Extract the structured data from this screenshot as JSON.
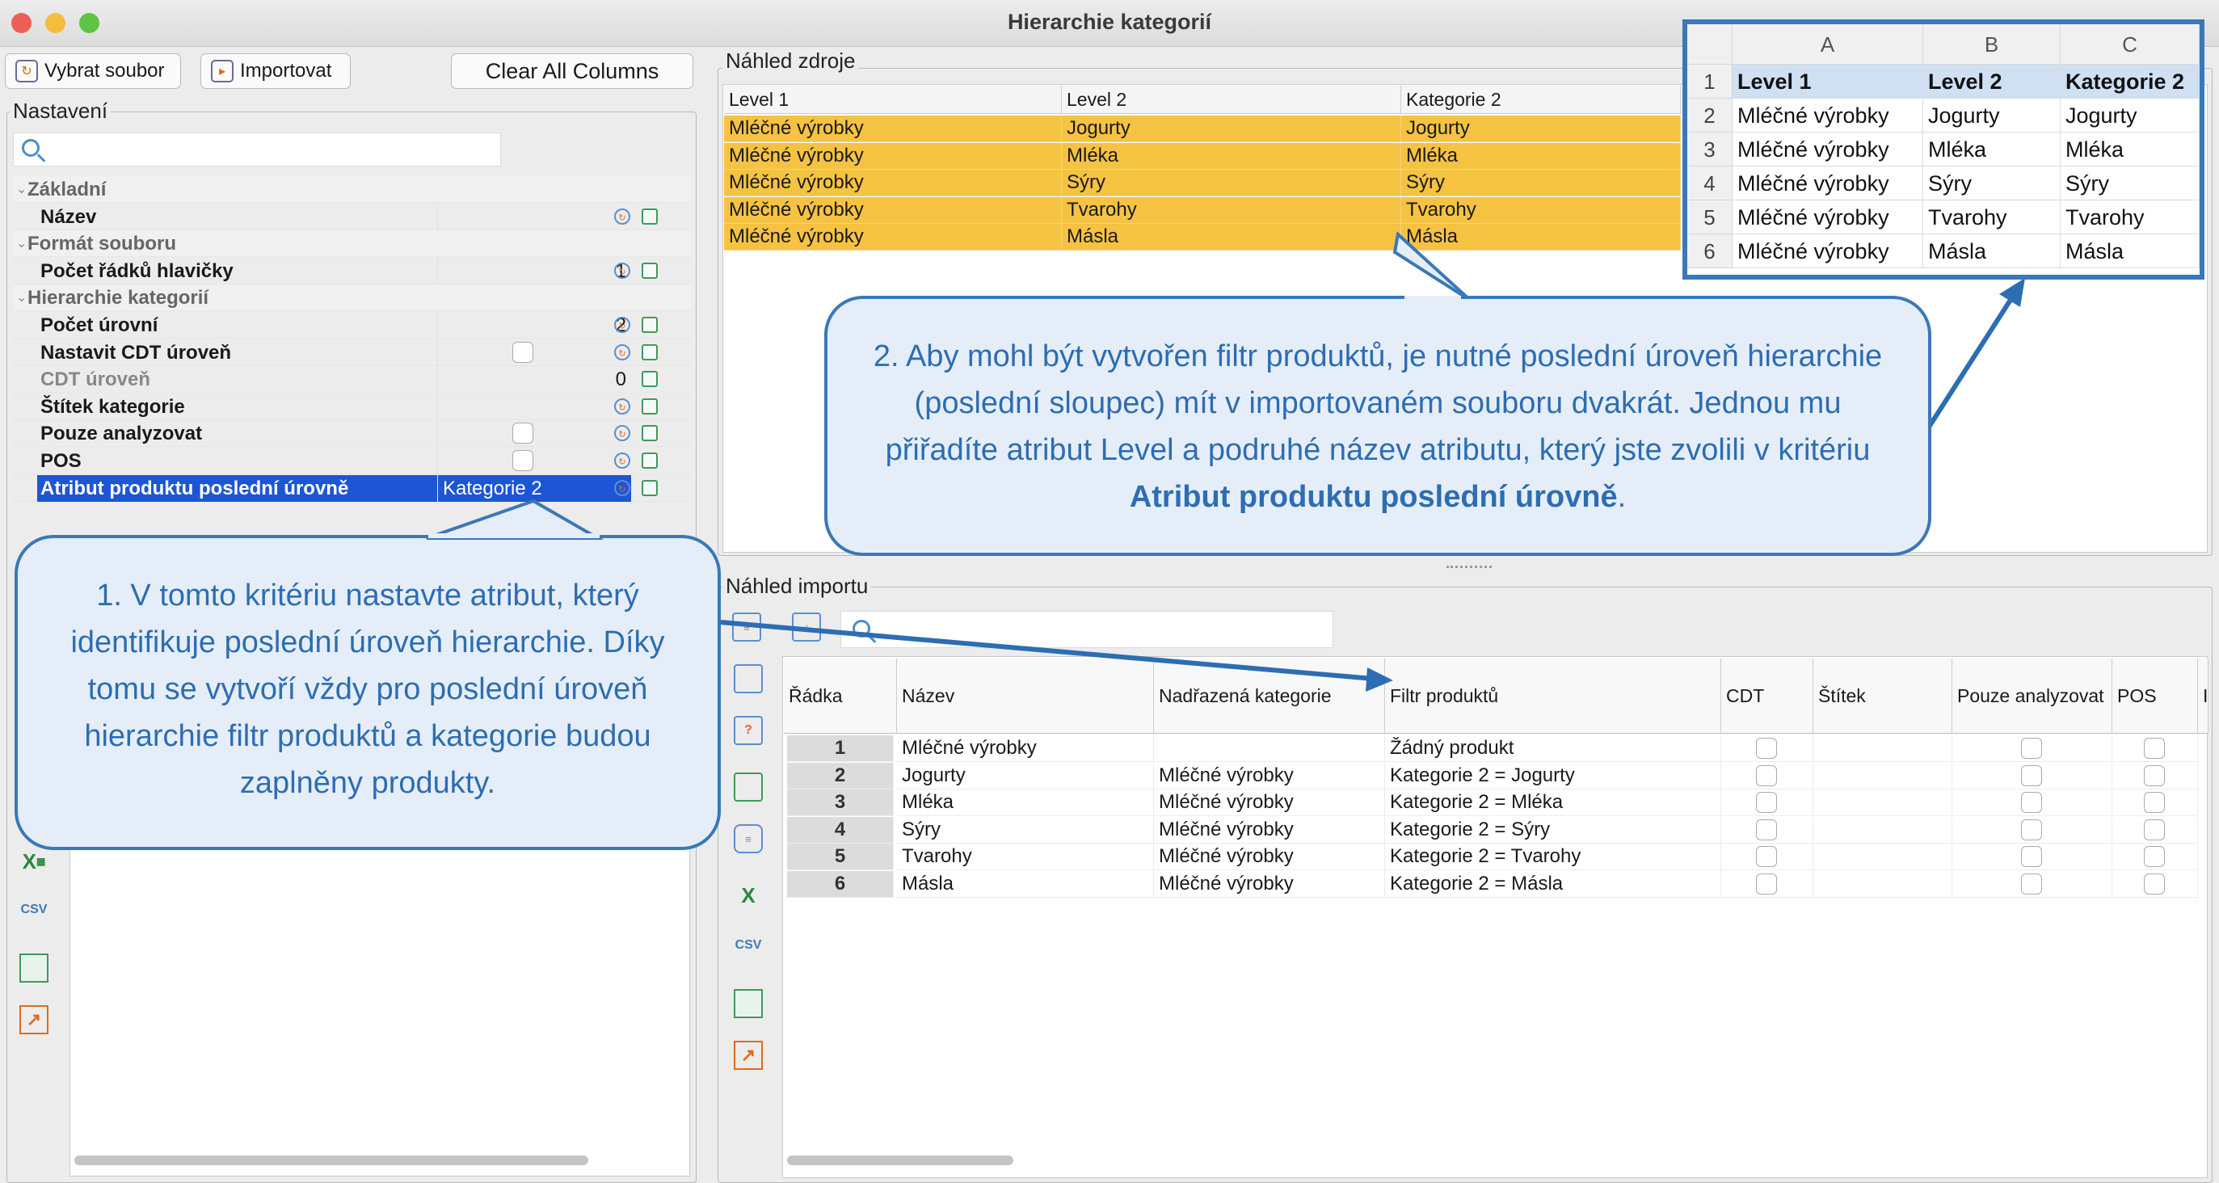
{
  "window": {
    "title": "Hierarchie kategorií"
  },
  "toolbar": {
    "select_file": "Vybrat soubor",
    "import": "Importovat",
    "clear_columns": "Clear All Columns"
  },
  "settings": {
    "group_label": "Nastavení",
    "rows": [
      {
        "label": "Základní",
        "value": ""
      },
      {
        "label": "Název",
        "value": ""
      },
      {
        "label": "Formát souboru",
        "value": ""
      },
      {
        "label": "Počet řádků hlavičky",
        "value": "1"
      },
      {
        "label": "Hierarchie kategorií",
        "value": ""
      },
      {
        "label": "Počet úrovní",
        "value": "2"
      },
      {
        "label": "Nastavit CDT úroveň",
        "value": ""
      },
      {
        "label": "CDT úroveň",
        "value": "0"
      },
      {
        "label": "Štítek kategorie",
        "value": ""
      },
      {
        "label": "Pouze analyzovat",
        "value": ""
      },
      {
        "label": "POS",
        "value": ""
      },
      {
        "label": "Atribut produktu poslední úrovně",
        "value": "Kategorie 2"
      }
    ]
  },
  "source_preview": {
    "label": "Náhled zdroje",
    "headers": [
      "Level 1",
      "Level 2",
      "Kategorie 2"
    ],
    "rows": [
      [
        "Mléčné výrobky",
        "Jogurty",
        "Jogurty"
      ],
      [
        "Mléčné výrobky",
        "Mléka",
        "Mléka"
      ],
      [
        "Mléčné výrobky",
        "Sýry",
        "Sýry"
      ],
      [
        "Mléčné výrobky",
        "Tvarohy",
        "Tvarohy"
      ],
      [
        "Mléčné výrobky",
        "Másla",
        "Másla"
      ]
    ]
  },
  "import_preview": {
    "label": "Náhled importu",
    "headers": [
      "Řádka",
      "Název",
      "Nadřazená kategorie",
      "Filtr produktů",
      "CDT",
      "Štítek",
      "Pouze analyzovat",
      "POS",
      "I"
    ],
    "rows": [
      [
        "1",
        "Mléčné výrobky",
        "",
        "Žádný produkt"
      ],
      [
        "2",
        "Jogurty",
        "Mléčné výrobky",
        "Kategorie 2 = Jogurty"
      ],
      [
        "3",
        "Mléka",
        "Mléčné výrobky",
        "Kategorie 2 = Mléka"
      ],
      [
        "4",
        "Sýry",
        "Mléčné výrobky",
        "Kategorie 2 = Sýry"
      ],
      [
        "5",
        "Tvarohy",
        "Mléčné výrobky",
        "Kategorie 2 = Tvarohy"
      ],
      [
        "6",
        "Másla",
        "Mléčné výrobky",
        "Kategorie 2 = Másla"
      ]
    ]
  },
  "excel": {
    "columns": [
      "A",
      "B",
      "C"
    ],
    "rows": [
      [
        "1",
        "Level 1",
        "Level 2",
        "Kategorie 2"
      ],
      [
        "2",
        "Mléčné výrobky",
        "Jogurty",
        "Jogurty"
      ],
      [
        "3",
        "Mléčné výrobky",
        "Mléka",
        "Mléka"
      ],
      [
        "4",
        "Mléčné výrobky",
        "Sýry",
        "Sýry"
      ],
      [
        "5",
        "Mléčné výrobky",
        "Tvarohy",
        "Tvarohy"
      ],
      [
        "6",
        "Mléčné výrobky",
        "Másla",
        "Másla"
      ]
    ]
  },
  "callout1": {
    "text": "1. V tomto kritériu nastavte atribut, který identifikuje poslední úroveň hierarchie. Díky tomu se vytvoří vždy pro poslední úroveň hierarchie filtr produktů a kategorie budou zaplněny produkty."
  },
  "callout2": {
    "text": "2. Aby mohl být vytvořen filtr produktů, je nutné poslední úroveň hierarchie (poslední sloupec) mít v importovaném souboru dvakrát. Jednou mu přiřadíte atribut Level a podruhé název atributu, který jste zvolili v kritériu",
    "bold": "Atribut produktu poslední úrovně",
    "end": "."
  },
  "side_icons": [
    "excel-icon",
    "csv-icon",
    "table-icon",
    "chart-icon"
  ],
  "side_labels": {
    "excel": "X",
    "csv": "CSV"
  }
}
